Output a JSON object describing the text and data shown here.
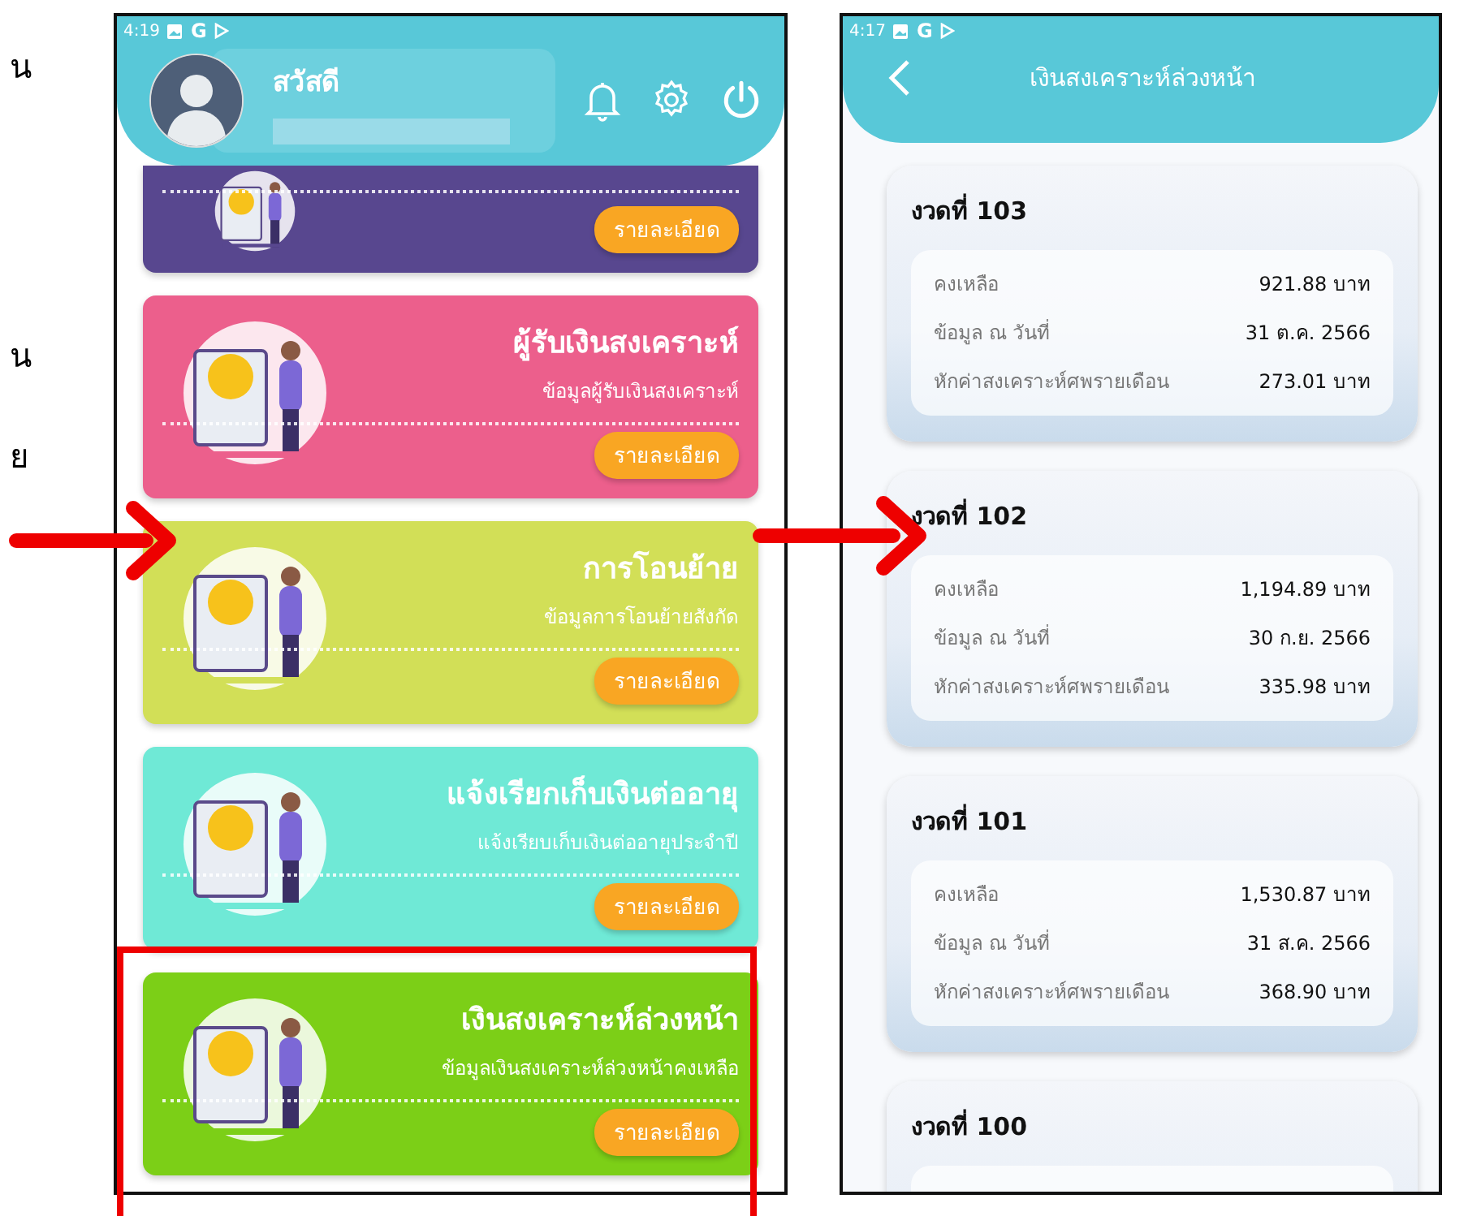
{
  "margin_fragments": [
    "น",
    "น",
    "ย"
  ],
  "left_phone": {
    "status_bar": {
      "time": "4:19",
      "letter": "G"
    },
    "header": {
      "greeting": "สวัสดี"
    },
    "cards": [
      {
        "color": "#58478f",
        "button": "รายละเอียด"
      },
      {
        "color": "#ec5f8c",
        "title": "ผู้รับเงินสงเคราะห์",
        "subtitle": "ข้อมูลผู้รับเงินสงเคราะห์",
        "button": "รายละเอียด"
      },
      {
        "color": "#d2df57",
        "title": "การโอนย้าย",
        "subtitle": "ข้อมูลการโอนย้ายสังกัด",
        "button": "รายละเอียด"
      },
      {
        "color": "#6fe9d6",
        "title": "แจ้งเรียกเก็บเงินต่ออายุ",
        "subtitle": "แจ้งเรียบเก็บเงินต่ออายุประจำปี",
        "button": "รายละเอียด"
      },
      {
        "color": "#7ccf17",
        "title": "เงินสงเคราะห์ล่วงหน้า",
        "subtitle": "ข้อมูลเงินสงเคราะห์ล่วงหน้าคงเหลือ",
        "button": "รายละเอียด"
      }
    ]
  },
  "right_phone": {
    "status_bar": {
      "time": "4:17",
      "letter": "G"
    },
    "title": "เงินสงเคราะห์ล่วงหน้า",
    "installments": [
      {
        "title": "งวดที่ 103",
        "rows": [
          {
            "label": "คงเหลือ",
            "value": "921.88 บาท"
          },
          {
            "label": "ข้อมูล ณ วันที่",
            "value": "31 ต.ค. 2566"
          },
          {
            "label": "หักค่าสงเคราะห์ศพรายเดือน",
            "value": "273.01 บาท"
          }
        ]
      },
      {
        "title": "งวดที่ 102",
        "rows": [
          {
            "label": "คงเหลือ",
            "value": "1,194.89 บาท"
          },
          {
            "label": "ข้อมูล ณ วันที่",
            "value": "30 ก.ย. 2566"
          },
          {
            "label": "หักค่าสงเคราะห์ศพรายเดือน",
            "value": "335.98 บาท"
          }
        ]
      },
      {
        "title": "งวดที่ 101",
        "rows": [
          {
            "label": "คงเหลือ",
            "value": "1,530.87 บาท"
          },
          {
            "label": "ข้อมูล ณ วันที่",
            "value": "31 ส.ค. 2566"
          },
          {
            "label": "หักค่าสงเคราะห์ศพรายเดือน",
            "value": "368.90 บาท"
          }
        ]
      },
      {
        "title": "งวดที่ 100"
      }
    ]
  }
}
